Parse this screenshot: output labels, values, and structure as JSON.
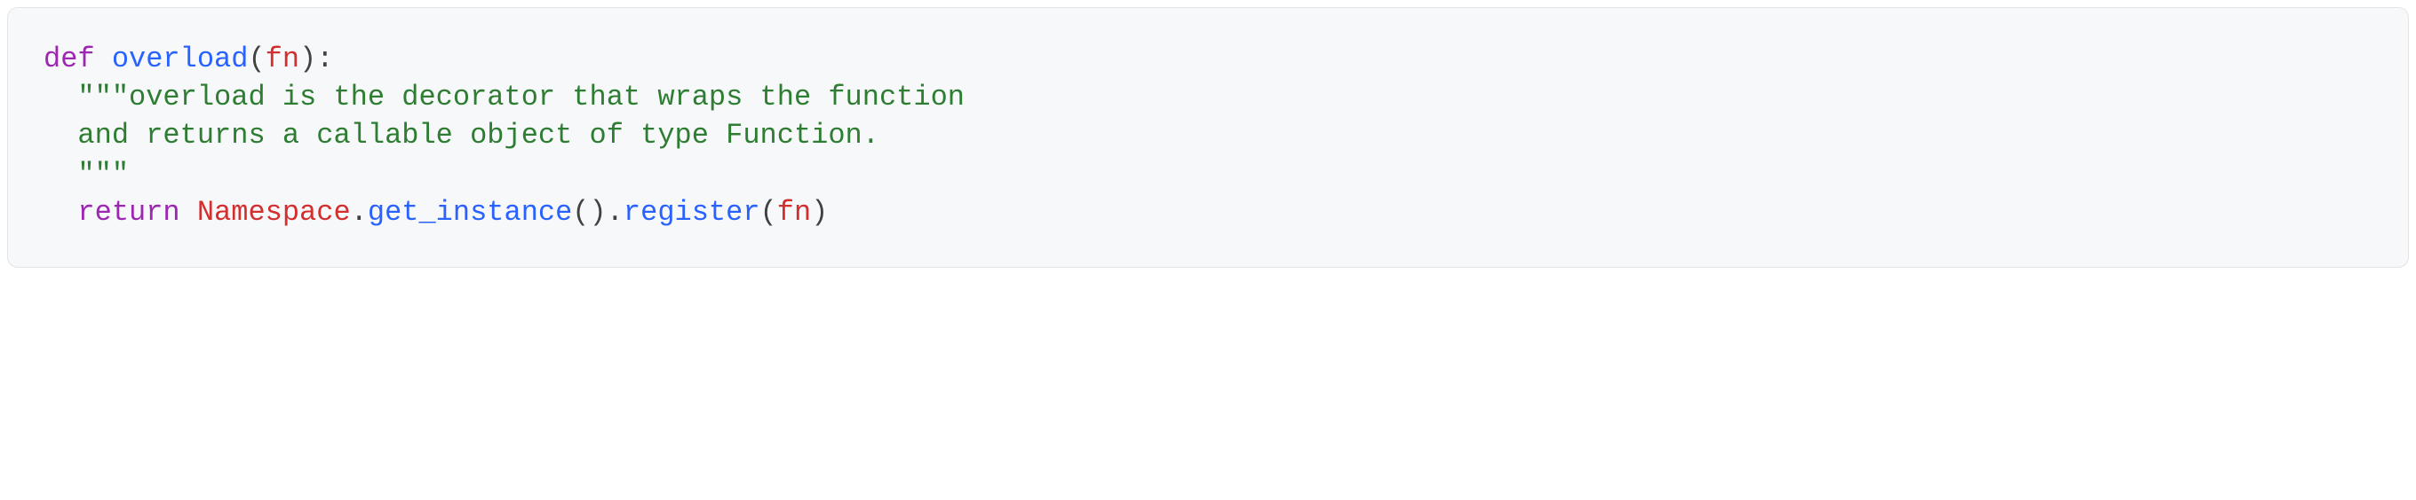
{
  "code": {
    "line1": {
      "kw_def": "def",
      "fn_name": "overload",
      "paren_open": "(",
      "param": "fn",
      "paren_close": ")",
      "colon": ":"
    },
    "line2": {
      "indent": "  ",
      "docstring": "\"\"\"overload is the decorator that wraps the function"
    },
    "line3": {
      "indent": "  ",
      "docstring": "and returns a callable object of type Function."
    },
    "line4": {
      "indent": "  ",
      "docstring": "\"\"\""
    },
    "line5": {
      "indent": "  ",
      "kw_return": "return",
      "cls": "Namespace",
      "dot1": ".",
      "method1": "get_instance",
      "call1": "()",
      "dot2": ".",
      "method2": "register",
      "paren_open": "(",
      "arg": "fn",
      "paren_close": ")"
    }
  }
}
